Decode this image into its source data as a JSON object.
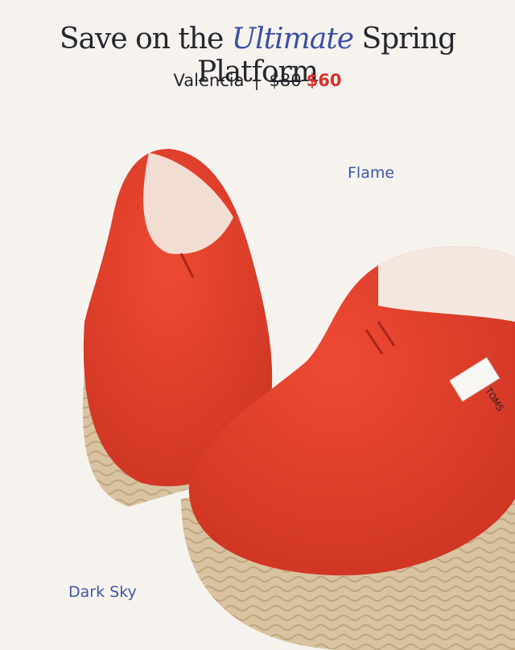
{
  "headline": {
    "prefix": "Save on the",
    "accent": "Ultimate",
    "suffix": "Spring Platform"
  },
  "product": {
    "name": "Valencia",
    "separator": "|",
    "old_price": "$80",
    "sale_price": "$60",
    "brand_tag": "TOMS"
  },
  "color_labels": {
    "top": "Flame",
    "bottom": "Dark Sky"
  },
  "colors": {
    "headline_text": "#26262e",
    "accent_text": "#3b50a6",
    "sale_price": "#d8322b",
    "label_text": "#3f58a7",
    "shoe_canvas": "#e8432f",
    "jute_sole": "#d9c3a0",
    "background": "#f6f3ef"
  }
}
